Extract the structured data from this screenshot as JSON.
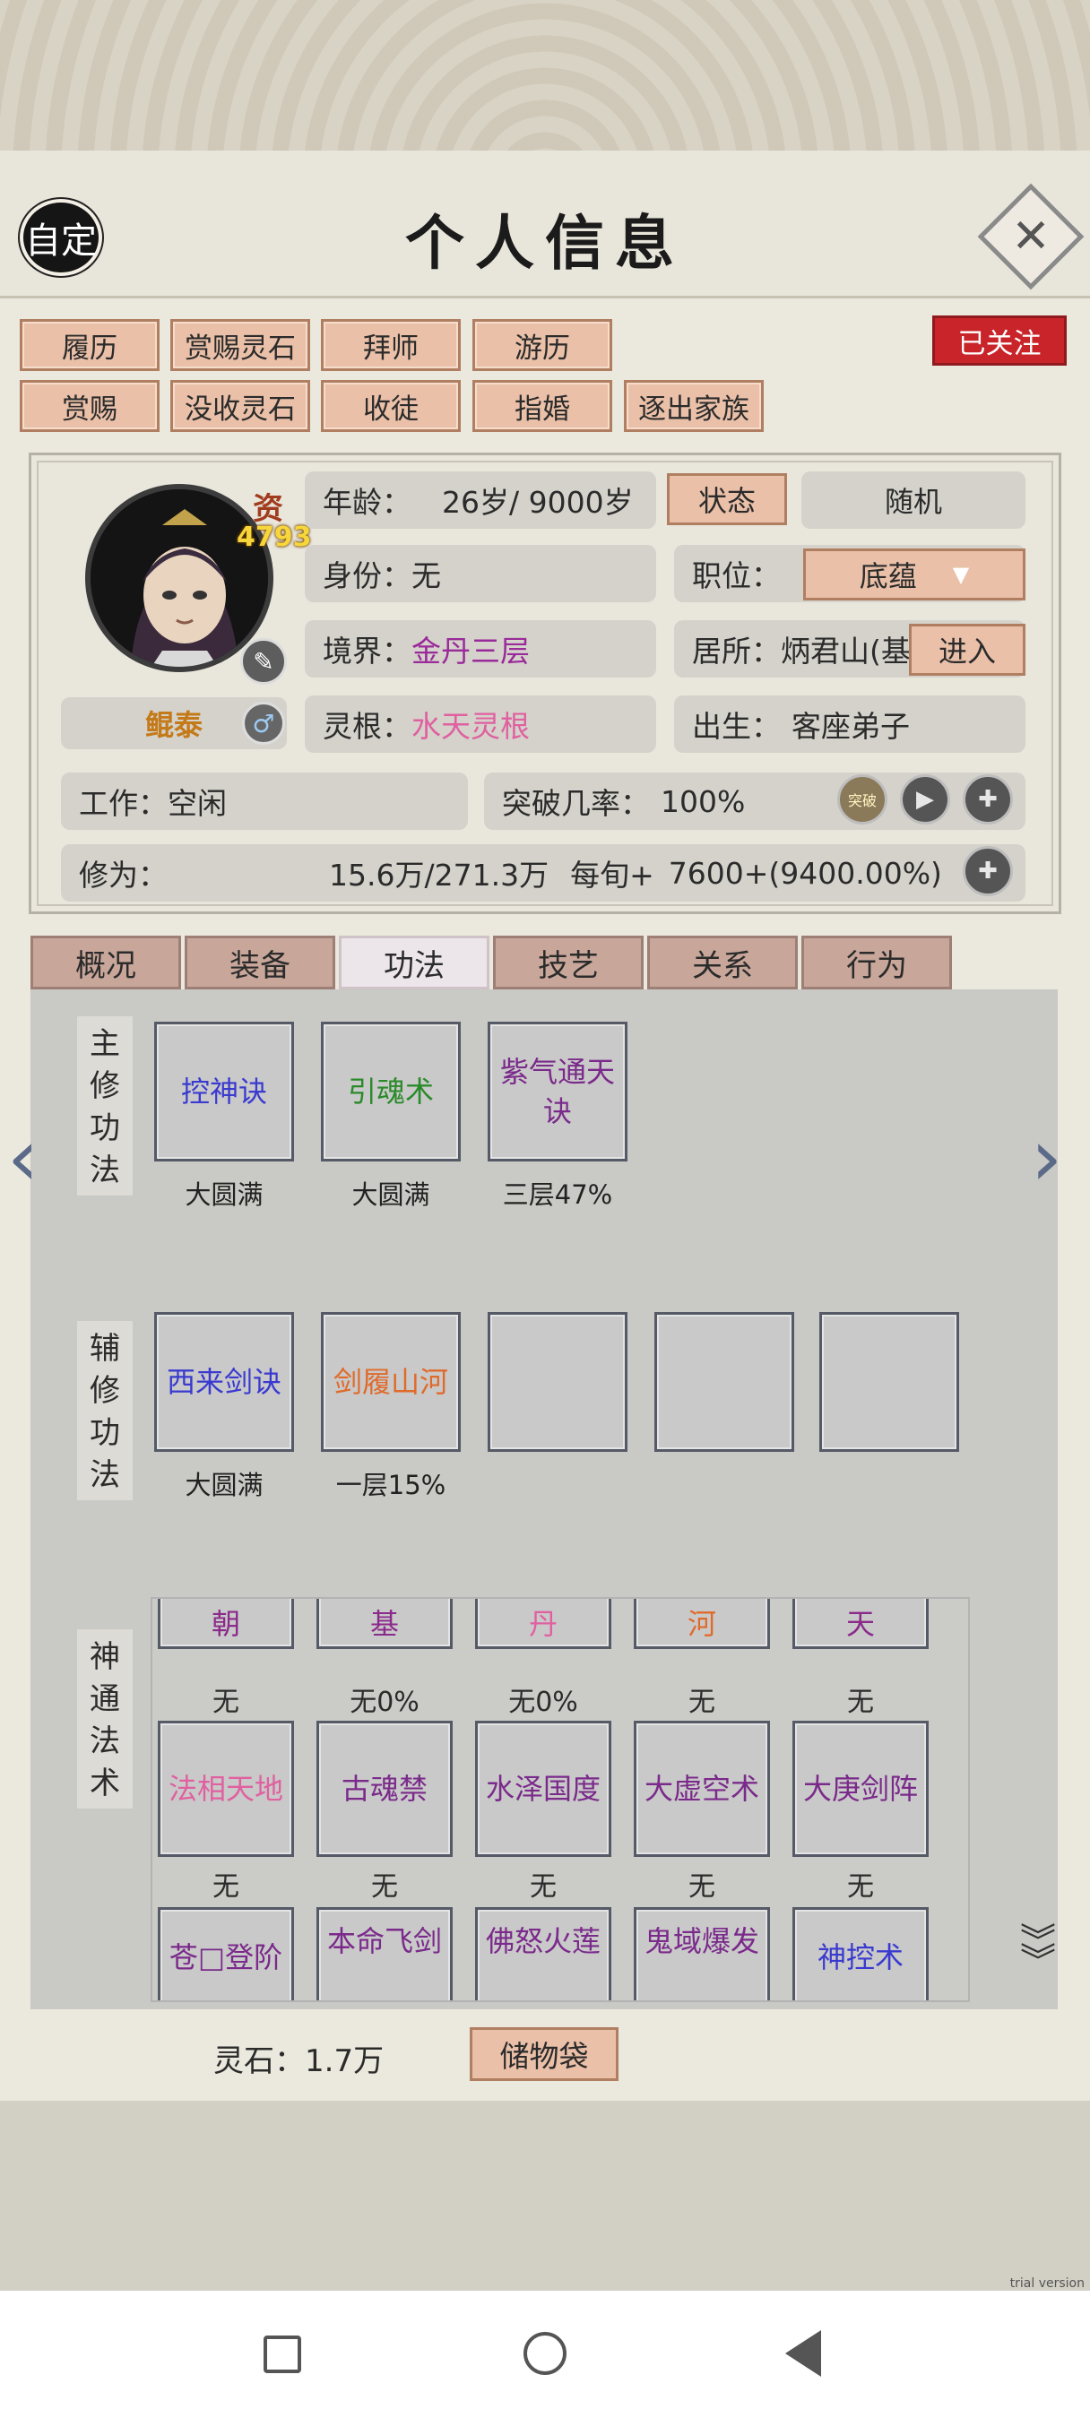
{
  "header": {
    "custom_btn": "自定",
    "title": "个人信息",
    "close_glyph": "✕"
  },
  "actions": {
    "row1": [
      "履历",
      "赏赐灵石",
      "拜师",
      "游历"
    ],
    "row2": [
      "赏赐",
      "没收灵石",
      "收徒",
      "指婚",
      "逐出家族"
    ],
    "followed": "已关注"
  },
  "profile": {
    "aptitude_label": "资",
    "aptitude_value": "4793",
    "name": "鲲泰",
    "gender_icon": "♂",
    "age_label": "年龄：",
    "age_value": "26岁/ 9000岁",
    "status_btn": "状态",
    "random_btn": "随机",
    "identity_label": "身份：",
    "identity_value": "无",
    "position_label": "职位：",
    "position_value": "底蕴",
    "realm_label": "境界：",
    "realm_value": "金丹三层",
    "residence_label": "居所：",
    "residence_value": "炳君山(基",
    "enter_btn": "进入",
    "root_label": "灵根：",
    "root_value": "水天灵根",
    "birth_label": "出生：",
    "birth_value": "客座弟子",
    "work_label": "工作：",
    "work_value": "空闲",
    "breakthrough_label": "突破几率：",
    "breakthrough_value": "100%",
    "breakthrough_icon_label": "突破",
    "cultivation_label": "修为：",
    "cultivation_value": "15.6万/271.3万",
    "per_turn_label": "每旬+",
    "per_turn_value": "7600+(9400.00%)"
  },
  "tabs": [
    "概况",
    "装备",
    "功法",
    "技艺",
    "关系",
    "行为"
  ],
  "main_skills": {
    "label": "主修功法",
    "items": [
      {
        "name": "控神诀",
        "status": "大圆满",
        "color": "#3a3ad0"
      },
      {
        "name": "引魂术",
        "status": "大圆满",
        "color": "#2a8a2a"
      },
      {
        "name": "紫气通天诀",
        "status": "三层47%",
        "color": "#7a2a8a"
      }
    ]
  },
  "aux_skills": {
    "label": "辅修功法",
    "items": [
      {
        "name": "西来剑诀",
        "status": "大圆满",
        "color": "#3a3ad0"
      },
      {
        "name": "剑履山河",
        "status": "一层15%",
        "color": "#e06a2a"
      },
      {
        "name": "",
        "status": ""
      },
      {
        "name": "",
        "status": ""
      },
      {
        "name": "",
        "status": ""
      }
    ]
  },
  "shentong": {
    "label": "神通法术",
    "row1": [
      {
        "name": "朝",
        "status": "无",
        "color": "#8a2a8a"
      },
      {
        "name": "基",
        "status": "无0%",
        "color": "#8a2a8a"
      },
      {
        "name": "丹",
        "status": "无0%",
        "color": "#e060a0"
      },
      {
        "name": "河",
        "status": "无",
        "color": "#e06a2a"
      },
      {
        "name": "天",
        "status": "无",
        "color": "#8a2a8a"
      }
    ],
    "row2": [
      {
        "name": "法相天地",
        "status": "无",
        "color": "#e060a0"
      },
      {
        "name": "古魂禁",
        "status": "无",
        "color": "#7a2a8a"
      },
      {
        "name": "水泽国度",
        "status": "无",
        "color": "#7a2a8a"
      },
      {
        "name": "大虚空术",
        "status": "无",
        "color": "#7a2a8a"
      },
      {
        "name": "大庚剑阵",
        "status": "无",
        "color": "#7a2a8a"
      }
    ],
    "row3": [
      {
        "name": "苍□登阶",
        "color": "#7a2a8a"
      },
      {
        "name": "本命飞剑",
        "color": "#7a2a8a"
      },
      {
        "name": "佛怒火莲",
        "color": "#7a2a8a"
      },
      {
        "name": "鬼域爆发",
        "color": "#7a2a8a"
      },
      {
        "name": "神控术",
        "color": "#3a3ad0"
      }
    ]
  },
  "footer": {
    "spirit_stone": "灵石：1.7万",
    "bag_btn": "储物袋"
  },
  "watermark": "trial version"
}
